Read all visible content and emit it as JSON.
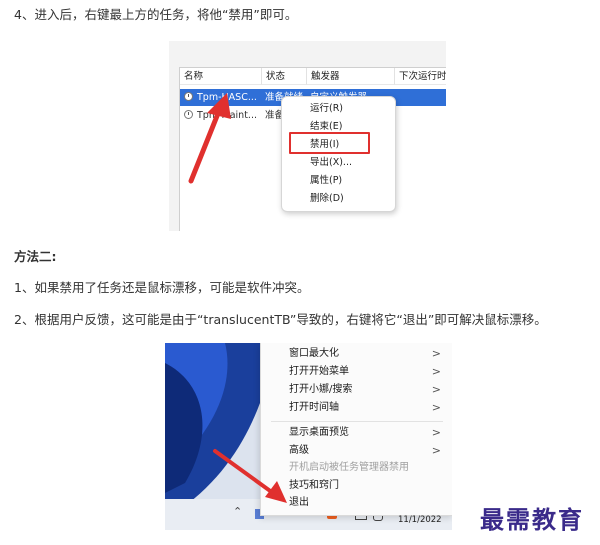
{
  "step4": "4、进入后，右键最上方的任务，将他“禁用”即可。",
  "screenshot1": {
    "columns": [
      "名称",
      "状态",
      "触发器",
      "下次运行时"
    ],
    "rows": [
      {
        "name": "Tpm-HASC...",
        "status": "准备就绪",
        "trigger": "自定义触发器"
      },
      {
        "name": "Tpm-Maint...",
        "status": "准备"
      }
    ],
    "menu": [
      "运行(R)",
      "结束(E)",
      "禁用(I)",
      "导出(X)...",
      "属性(P)",
      "删除(D)"
    ]
  },
  "method2_heading": "方法二:",
  "point1": "1、如果禁用了任务还是鼠标漂移，可能是软件冲突。",
  "point2": "2、根据用户反馈，这可能是由于“translucentTB”导致的，右键将它“退出”即可解决鼠标漂移。",
  "screenshot2": {
    "menu": [
      {
        "label": "窗口最大化",
        "chevron": ">"
      },
      {
        "label": "打开开始菜单",
        "chevron": ">"
      },
      {
        "label": "打开小娜/搜索",
        "chevron": ">"
      },
      {
        "label": "打开时间轴",
        "chevron": ">"
      },
      {
        "label": "显示桌面预览",
        "chevron": ">"
      },
      {
        "label": "高级",
        "chevron": ">"
      },
      {
        "label": "开机启动被任务管理器禁用"
      },
      {
        "label": "技巧和窍门"
      },
      {
        "label": "退出"
      }
    ],
    "date": "11/1/2022"
  },
  "watermark": "最需教育",
  "colors": {
    "arrow": "#e0302e",
    "selection": "#2f6fd7",
    "watermark": "#3a2a8a"
  }
}
